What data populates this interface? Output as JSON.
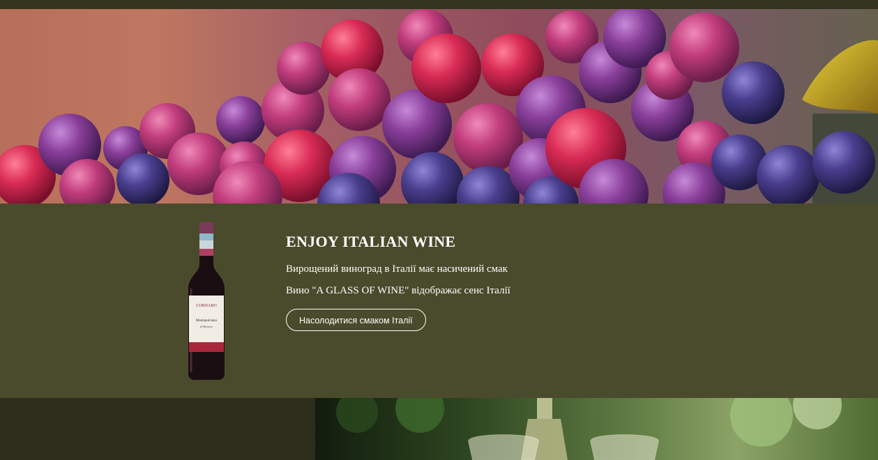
{
  "product": {
    "title": "ENJOY ITALIAN WINE",
    "line1": "Вирощений виноград в Італії має насичений смак",
    "line2": "Вино \"A GLASS OF WINE\" відображає сенс Італії",
    "cta_label": "Насолодитися смаком Італії"
  },
  "bottle_label": {
    "brand": "CORNARO",
    "varietal": "Montepulciano",
    "region": "d'Abruzzo"
  },
  "colors": {
    "section_bg": "#4a4b2c",
    "page_bg": "#2d2f1c",
    "text": "#ffffff"
  }
}
